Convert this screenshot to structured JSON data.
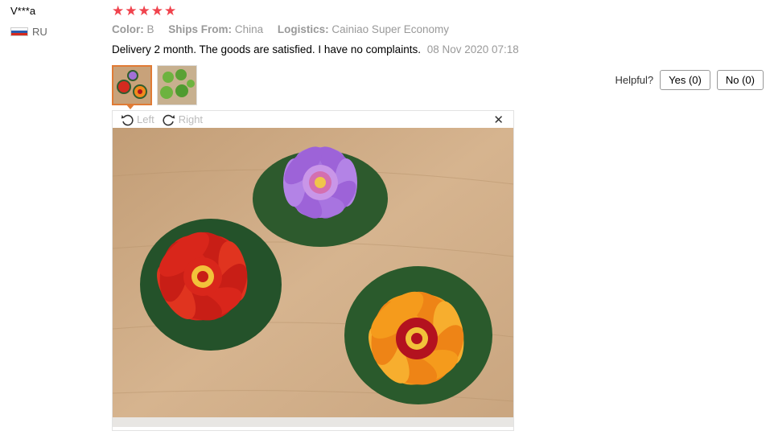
{
  "reviewer": {
    "name": "V***a",
    "country": "RU",
    "flag_colors": [
      "#ffffff",
      "#2a5cae",
      "#d52b1e"
    ]
  },
  "rating": {
    "stars": 5,
    "max": 5,
    "star_color": "#f0434d"
  },
  "attributes": {
    "color_label": "Color:",
    "color_value": "B",
    "ships_label": "Ships From:",
    "ships_value": "China",
    "logistics_label": "Logistics:",
    "logistics_value": "Cainiao Super Economy"
  },
  "review": {
    "text": "Delivery 2 month. The goods are satisfied. I have no complaints.",
    "date": "08 Nov 2020 07:18"
  },
  "thumbnails": [
    {
      "name": "thumbnail-1",
      "active": true,
      "icon": "lotus-flowers-photo"
    },
    {
      "name": "thumbnail-2",
      "active": false,
      "icon": "green-leaves-photo"
    }
  ],
  "helpful": {
    "label": "Helpful?",
    "yes_label": "Yes (0)",
    "no_label": "No (0)"
  },
  "viewer": {
    "rotate_left_label": "Left",
    "rotate_right_label": "Right",
    "close_icon": "close-icon",
    "photo": "three artificial lotus flowers (purple, red, orange) on wooden table"
  },
  "colors": {
    "accent": "#e07b35",
    "muted_text": "#999999"
  }
}
